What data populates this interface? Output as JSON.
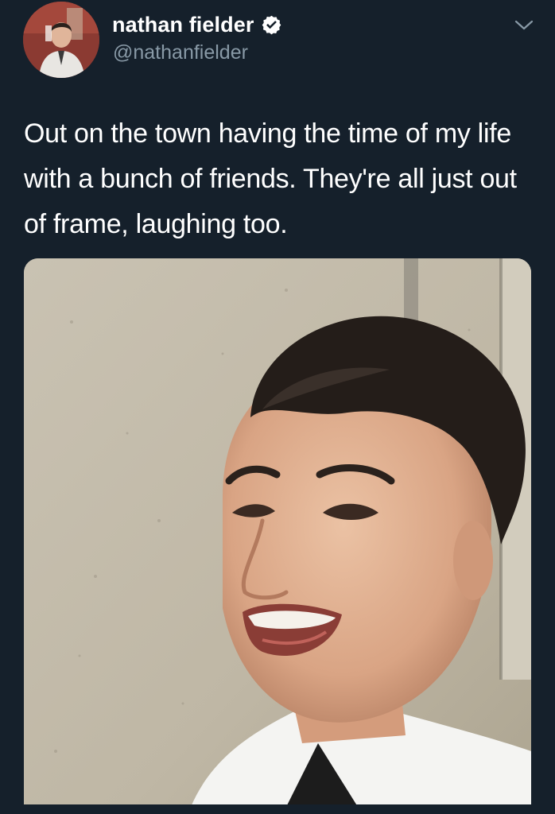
{
  "tweet": {
    "author": {
      "display_name": "nathan fielder",
      "handle": "@nathanfielder",
      "verified": true,
      "avatar_icon": "profile-photo"
    },
    "text": "Out on the town having the time of my life with a bunch of friends. They're all just out of frame, laughing too.",
    "media": {
      "type": "photo",
      "icon": "photo-of-smiling-man"
    },
    "menu_icon": "chevron-down-icon"
  },
  "theme": {
    "background": "#15202b",
    "secondary_text": "#8899a6",
    "verified_color": "#ffffff"
  }
}
